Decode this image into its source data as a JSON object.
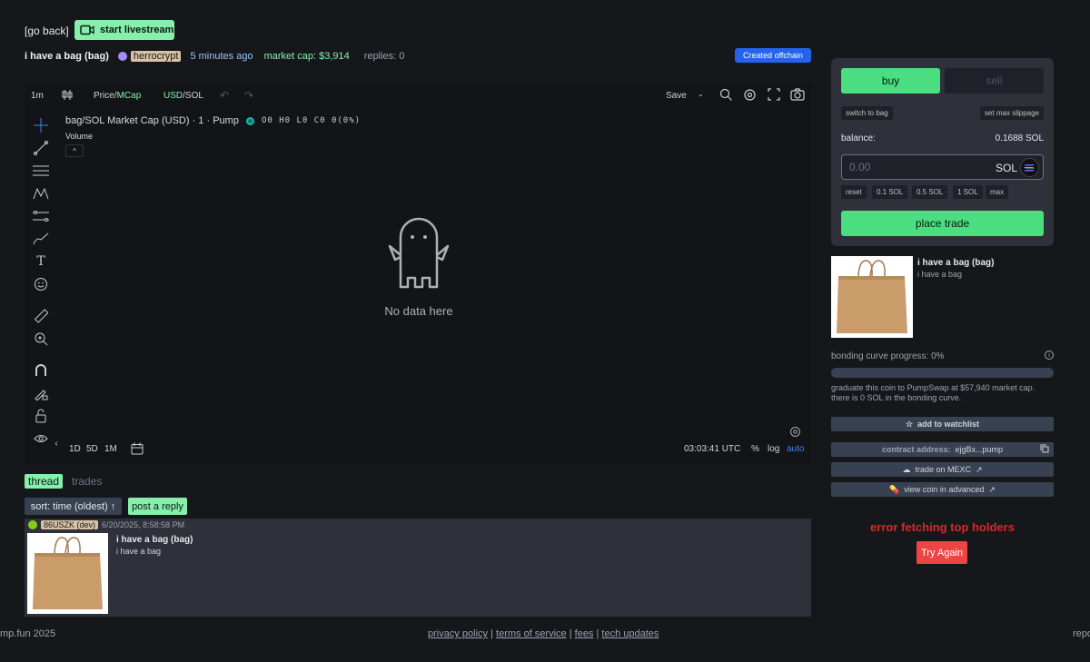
{
  "header": {
    "go_back": "[go back]",
    "livestream": "start livestream",
    "coin_name": "i have a bag (bag)",
    "creator": "herrocrypt",
    "time_ago": "5 minutes ago",
    "market_cap": "market cap: $3,914",
    "replies": "replies: 0",
    "offchain_badge": "Created offchain"
  },
  "chart_toolbar": {
    "interval": "1m",
    "price_label": "Price",
    "mcap_label": "MCap",
    "usd_label": "USD",
    "sol_label": "SOL",
    "save": "Save"
  },
  "chart": {
    "title": "bag/SOL Market Cap (USD) · 1 · Pump",
    "ohlc": "O0 H0 L0 C0 0(0%)",
    "volume": "Volume",
    "no_data": "No data here",
    "ranges": [
      "1D",
      "5D",
      "1M"
    ],
    "time": "03:03:41 UTC",
    "percent": "%",
    "log": "log",
    "auto": "auto"
  },
  "thread": {
    "tab_thread": "thread",
    "tab_trades": "trades",
    "sort": "sort: time (oldest) ↑",
    "post_reply": "post a reply",
    "post": {
      "user": "86USZK (dev)",
      "date": "6/20/2025, 8:58:58 PM",
      "title": "i have a bag (bag)",
      "body": "i have a bag"
    }
  },
  "footer": {
    "left": "mp.fun 2025",
    "privacy": "privacy policy",
    "terms": "terms of service",
    "fees": "fees",
    "tech": "tech updates",
    "sep": "|",
    "right": "repo"
  },
  "trade": {
    "buy": "buy",
    "sell": "sell",
    "switch": "switch to bag",
    "slippage": "set max slippage",
    "balance_label": "balance:",
    "balance_value": "0.1688 SOL",
    "amount_placeholder": "0.00",
    "currency": "SOL",
    "quick": [
      "reset",
      "0.1 SOL",
      "0.5 SOL",
      "1 SOL",
      "max"
    ],
    "place_trade": "place trade"
  },
  "coin_info": {
    "title": "i have a bag (bag)",
    "sub": "i have a bag",
    "bonding_label": "bonding curve progress: 0%",
    "bonding_progress": 0,
    "graduate_text": "graduate this coin to PumpSwap at $57,940 market cap. there is 0 SOL in the bonding curve.",
    "watchlist": "add to watchlist",
    "contract_label": "contract address:",
    "contract_value": "ejgBx...pump",
    "mexc": "trade on MEXC",
    "advanced": "view coin in advanced",
    "error": "error fetching top holders",
    "try_again": "Try Again"
  },
  "colors": {
    "accent_green": "#86efac",
    "buy_green": "#4ade80",
    "blue": "#2563eb",
    "error_red": "#dc2626"
  }
}
